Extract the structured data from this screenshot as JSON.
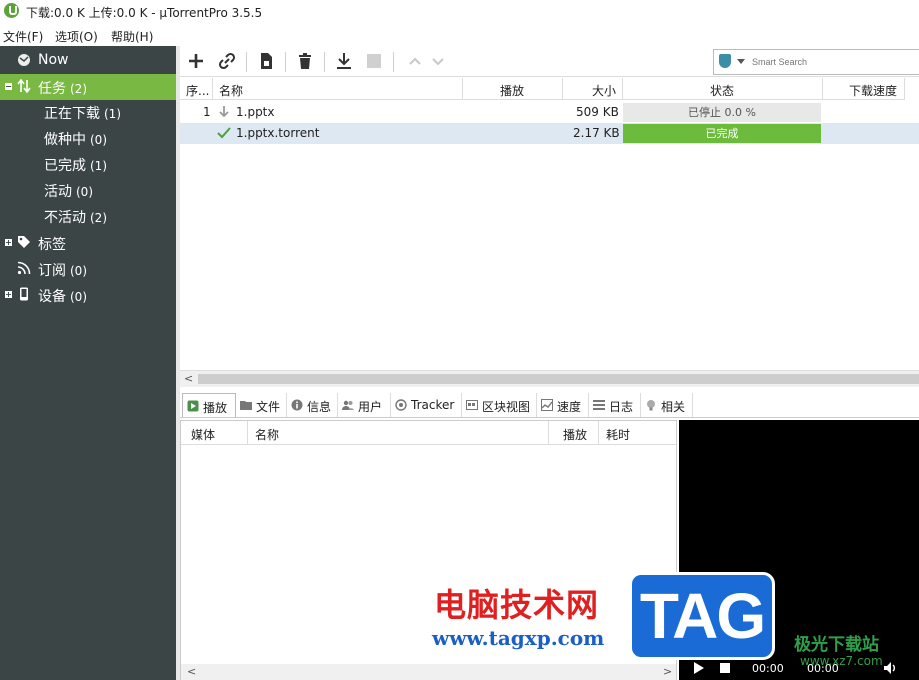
{
  "window": {
    "title": "下载:0.0 K 上传:0.0 K - µTorrentPro 3.5.5"
  },
  "menu": [
    "文件(F)",
    "选项(O)",
    "帮助(H)"
  ],
  "sidebar": {
    "now": "Now",
    "tasks": {
      "label": "任务",
      "count": "(2)"
    },
    "items": [
      {
        "label": "正在下载",
        "count": "(1)"
      },
      {
        "label": "做种中",
        "count": "(0)"
      },
      {
        "label": "已完成",
        "count": "(1)"
      },
      {
        "label": "活动",
        "count": "(0)"
      },
      {
        "label": "不活动",
        "count": "(2)"
      }
    ],
    "labels": {
      "label": "标签"
    },
    "feeds": {
      "label": "订阅",
      "count": "(0)"
    },
    "devices": {
      "label": "设备",
      "count": "(0)"
    }
  },
  "search": {
    "placeholder": "Smart Search"
  },
  "list": {
    "columns": [
      "序...",
      "名称",
      "播放",
      "大小",
      "状态",
      "下载速度"
    ],
    "rows": [
      {
        "num": "1",
        "name": "1.pptx",
        "size": "509 KB",
        "status": "已停止 0.0 %",
        "progress": 0.0,
        "complete": false
      },
      {
        "num": "",
        "name": "1.pptx.torrent",
        "size": "2.17 KB",
        "status": "已完成",
        "progress": 1.0,
        "complete": true
      }
    ]
  },
  "tabs": [
    "播放",
    "文件",
    "信息",
    "用户",
    "Tracker",
    "区块视图",
    "速度",
    "日志",
    "相关"
  ],
  "media": {
    "columns": [
      "媒体",
      "名称",
      "播放",
      "耗时"
    ]
  },
  "player": {
    "time_current": "00:00",
    "time_total": "00:00"
  },
  "watermark": {
    "site_name": "电脑技术网",
    "url": "www.tagxp.com",
    "tag": "TAG",
    "corner_text": "极光下载站",
    "corner_url": "www.xz7.com"
  },
  "colors": {
    "sidebar_bg": "#3c4546",
    "accent_green": "#78b843",
    "complete_bar": "#6cbb3c",
    "selected_row": "#dde8f3"
  }
}
